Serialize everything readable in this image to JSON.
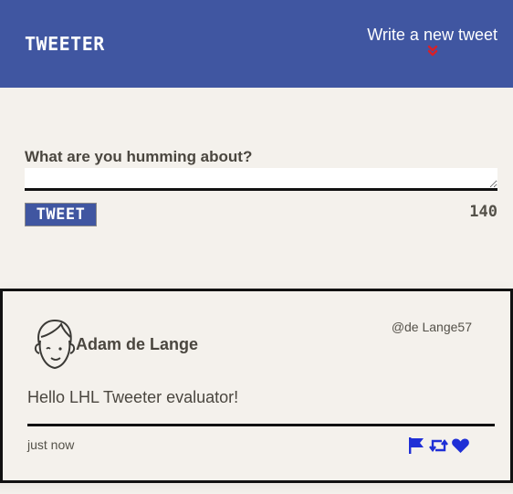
{
  "nav": {
    "brand": "Tweeter",
    "compose_label": "Write a new tweet",
    "compose_icon": "double-chevron-down-icon"
  },
  "compose": {
    "question": "What are you humming about?",
    "input_value": "",
    "input_placeholder": "",
    "submit_label": "Tweet",
    "char_counter": "140"
  },
  "tweets": [
    {
      "avatar_icon": "face-avatar-icon",
      "name": "Adam de Lange",
      "handle": "@de Lange57",
      "text": "Hello LHL Tweeter evaluator!",
      "timestamp": "just now",
      "actions": [
        "flag-icon",
        "retweet-icon",
        "heart-icon"
      ]
    }
  ],
  "colors": {
    "nav_background": "#4056a1",
    "page_background": "#f4f1ec",
    "accent_red": "#d92027",
    "action_icon_blue": "#1f2fd6",
    "border_black": "#111111"
  }
}
